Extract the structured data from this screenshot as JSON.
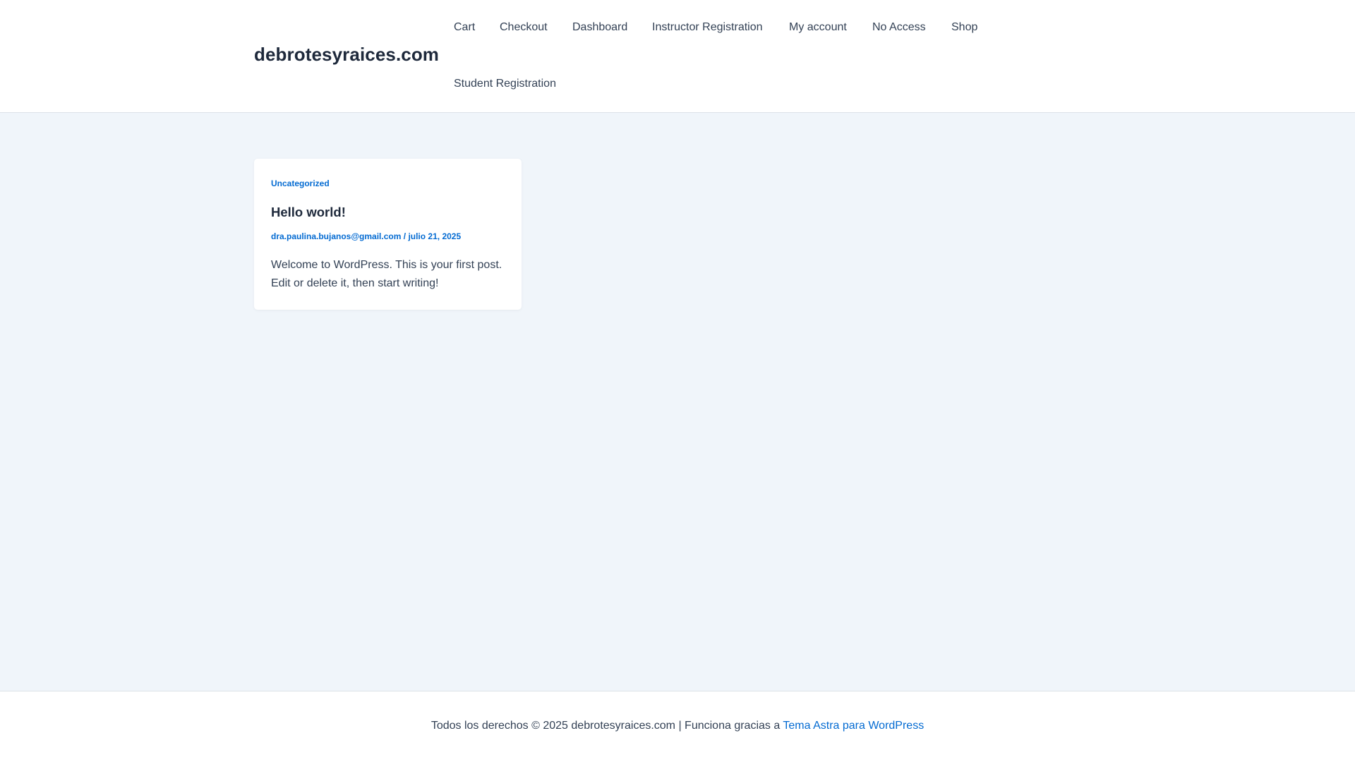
{
  "header": {
    "site_title": "debrotesyraices.com",
    "nav": [
      "Cart",
      "Checkout",
      "Dashboard",
      "Instructor Registration",
      "My account",
      "No Access",
      "Shop",
      "Student Registration"
    ]
  },
  "post": {
    "category": "Uncategorized",
    "title": "Hello world!",
    "author": "dra.paulina.bujanos@gmail.com",
    "separator": "/",
    "date": "julio 21, 2025",
    "excerpt": "Welcome to WordPress. This is your first post. Edit or delete it, then start writing!"
  },
  "footer": {
    "text": "Todos los derechos © 2025 debrotesyraices.com | Funciona gracias a ",
    "link_text": "Tema Astra para WordPress"
  },
  "colors": {
    "accent": "#046bd2",
    "heading": "#1e293b",
    "body_text": "#334155",
    "page_background": "#f0f5fa"
  }
}
